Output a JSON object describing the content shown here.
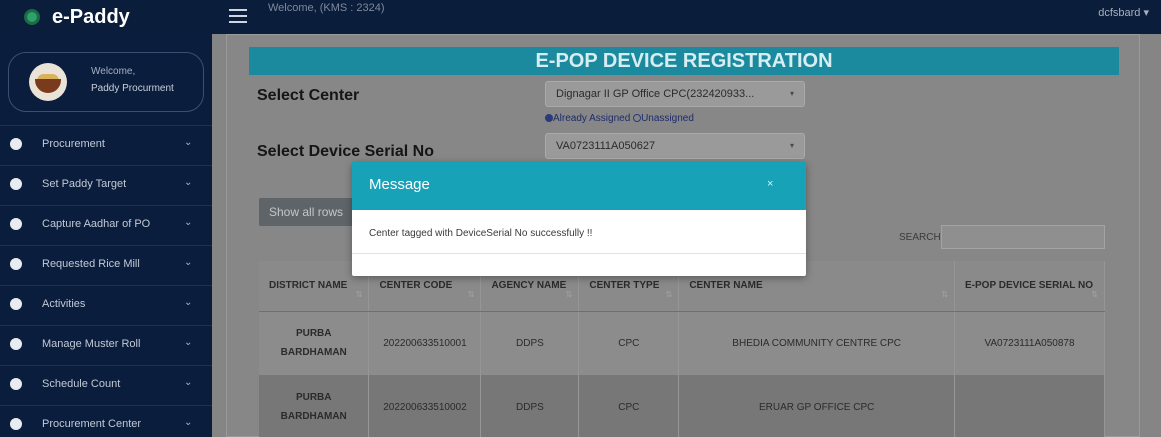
{
  "app": {
    "brand": "e-Paddy",
    "welcome_top": "Welcome, (KMS : 2324)",
    "user_menu": "dcfsbard ▾"
  },
  "sidebar": {
    "welcome": "Welcome,",
    "user_name": "Paddy Procurment",
    "items": [
      {
        "label": "Procurement",
        "icon": "circle-icon"
      },
      {
        "label": "Set Paddy Target",
        "icon": "circle-icon"
      },
      {
        "label": "Capture Aadhar of PO",
        "icon": "circle-icon"
      },
      {
        "label": "Requested Rice Mill",
        "icon": "circle-icon"
      },
      {
        "label": "Activities",
        "icon": "circle-icon"
      },
      {
        "label": "Manage Muster Roll",
        "icon": "circle-icon"
      },
      {
        "label": "Schedule Count",
        "icon": "circle-icon"
      },
      {
        "label": "Procurement Center",
        "icon": "circle-icon"
      }
    ]
  },
  "page": {
    "title": "E-POP DEVICE REGISTRATION",
    "select_center_label": "Select Center",
    "select_center_value": "Dignagar II GP Office CPC(232420933...",
    "radio_assigned": "Already Assigned",
    "radio_unassigned": "Unassigned",
    "select_serial_label": "Select Device Serial No",
    "select_serial_value": "VA0723111A050627",
    "show_all_button": "Show all rows",
    "search_label": "SEARCH:"
  },
  "table": {
    "headers": [
      "DISTRICT NAME",
      "CENTER CODE",
      "AGENCY NAME",
      "CENTER TYPE",
      "CENTER NAME",
      "E-POP DEVICE SERIAL NO"
    ],
    "rows": [
      [
        "PURBA BARDHAMAN",
        "202200633510001",
        "DDPS",
        "CPC",
        "BHEDIA COMMUNITY CENTRE CPC",
        "VA0723111A050878"
      ],
      [
        "PURBA BARDHAMAN",
        "202200633510002",
        "DDPS",
        "CPC",
        "ERUAR GP OFFICE CPC",
        ""
      ]
    ]
  },
  "modal": {
    "title": "Message",
    "close_label": "×",
    "message": "Center tagged with DeviceSerial No successfully !!"
  },
  "colors": {
    "accent": "#17a2b8",
    "title_bar": "#1b8a9e",
    "sidebar": "#0b1d3c"
  }
}
